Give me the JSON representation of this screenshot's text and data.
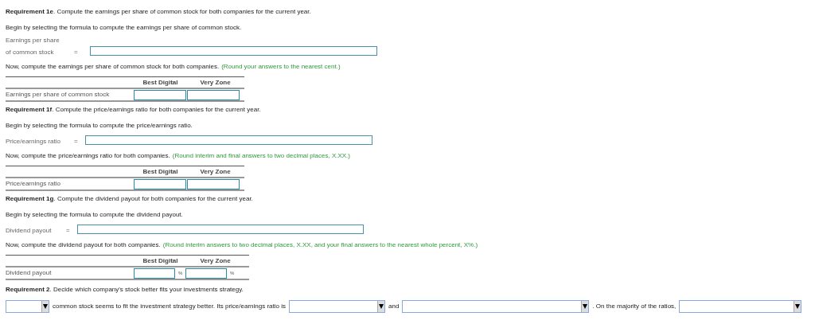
{
  "sections": [
    {
      "requirement": "**Requirement 1e**. Compute the earnings per share of common stock for both companies for the current year.",
      "begin": "Begin by selecting the formula to compute the earnings per share of common stock.",
      "formula_label": [
        "Earnings per share",
        "of common stock"
      ],
      "equals": "=",
      "now": "Now, compute the earnings per share of common stock for both companies.",
      "note": "(Round your answers to the nearest cent.)",
      "columns": [
        "Best Digital",
        "Very Zone"
      ],
      "row_label": "Earnings per share of common stock"
    },
    {
      "requirement": "**Requirement 1f**. Compute the price/earnings ratio for both companies for the current year.",
      "begin": "Begin by selecting the formula to compute the price/earnings ratio.",
      "formula_label": [
        "Price/earnings ratio"
      ],
      "equals": "=",
      "now": "Now, compute the price/earnings ratio for both companies.",
      "note": "(Round interim and final answers to two decimal places, X.XX.)",
      "columns": [
        "Best Digital",
        "Very Zone"
      ],
      "row_label": "Price/earnings ratio"
    },
    {
      "requirement": "**Requirement 1g**. Compute the dividend payout for both companies for the current year.",
      "begin": "Begin by selecting the formula to compute the dividend payout.",
      "formula_label": [
        "Dividend payout"
      ],
      "equals": "=",
      "now": "Now, compute the dividend payout for both companies.",
      "note": "(Round interim answers to two decimal places, X.XX, and your final answers to the nearest whole percent, X%.)",
      "columns": [
        "Best Digital",
        "Very Zone"
      ],
      "row_label": "Dividend payout",
      "suffix": "%"
    }
  ],
  "requirement2": {
    "text": "**Requirement 2**. Decide which company's stock better fits your investments strategy.",
    "sentence": [
      {
        "kind": "dropdown"
      },
      {
        "kind": "text",
        "text": "common stock seems to fit the investment strategy better. Its price/earnings ratio is"
      },
      {
        "kind": "dropdown"
      },
      {
        "kind": "text",
        "text": "and"
      },
      {
        "kind": "dropdown"
      },
      {
        "kind": "text",
        "text": ". On the majority of the ratios,"
      },
      {
        "kind": "dropdown"
      }
    ]
  }
}
